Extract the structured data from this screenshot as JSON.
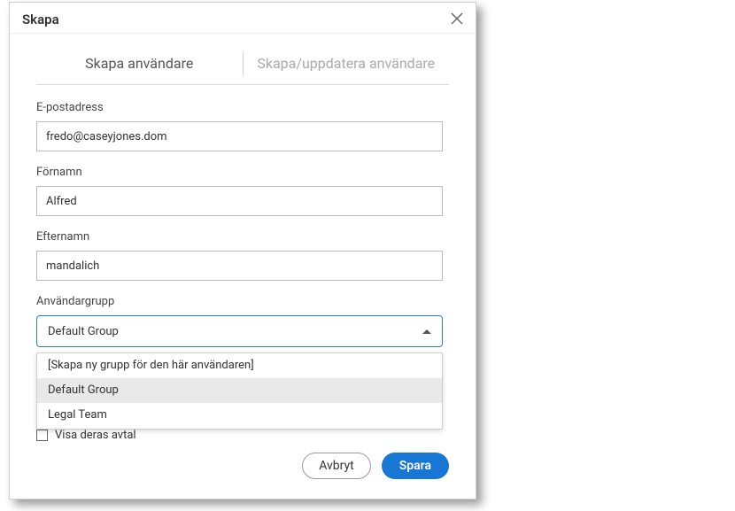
{
  "dialog": {
    "title": "Skapa"
  },
  "tabs": {
    "createUser": "Skapa användare",
    "createUpdateUser": "Skapa/uppdatera användare"
  },
  "fields": {
    "email": {
      "label": "E-postadress",
      "value": "fredo@caseyjones.dom"
    },
    "firstName": {
      "label": "Förnamn",
      "value": "Alfred"
    },
    "lastName": {
      "label": "Efternamn",
      "value": "mandalich"
    },
    "userGroup": {
      "label": "Användargrupp",
      "selected": "Default Group",
      "options": [
        "[Skapa ny grupp för den här användaren]",
        "Default Group",
        "Legal Team"
      ]
    }
  },
  "checkbox": {
    "label": "Visa deras avtal",
    "checked": false
  },
  "buttons": {
    "cancel": "Avbryt",
    "save": "Spara"
  }
}
